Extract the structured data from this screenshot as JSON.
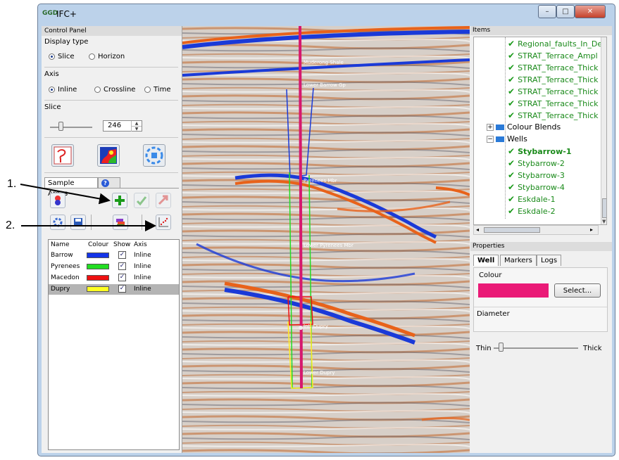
{
  "window": {
    "title": "IFC+",
    "minimize": "–",
    "maximize": "□",
    "close": "✕"
  },
  "control_panel": {
    "title": "Control Panel",
    "display_type": {
      "label": "Display type",
      "options": [
        {
          "label": "Slice",
          "selected": true
        },
        {
          "label": "Horizon",
          "selected": false
        }
      ]
    },
    "axis": {
      "label": "Axis",
      "options": [
        {
          "label": "Inline",
          "selected": true
        },
        {
          "label": "Crossline",
          "selected": false
        },
        {
          "label": "Time",
          "selected": false
        }
      ]
    },
    "slice": {
      "label": "Slice",
      "value": "246"
    },
    "tabs": [
      {
        "label": "Sample Areas",
        "active": true
      },
      {
        "label": "?",
        "active": false
      }
    ],
    "table": {
      "headers": [
        "Name",
        "Colour",
        "Show",
        "Axis"
      ],
      "rows": [
        {
          "name": "Barrow",
          "colour": "#1434e8",
          "show": true,
          "axis": "Inline",
          "selected": false
        },
        {
          "name": "Pyrenees",
          "colour": "#22dd22",
          "show": true,
          "axis": "Inline",
          "selected": false
        },
        {
          "name": "Macedon",
          "colour": "#ee1111",
          "show": true,
          "axis": "Inline",
          "selected": false
        },
        {
          "name": "Dupry",
          "colour": "#ffff22",
          "show": true,
          "axis": "Inline",
          "selected": true
        }
      ]
    }
  },
  "annotations": [
    {
      "label": "1."
    },
    {
      "label": "2."
    }
  ],
  "seismic": {
    "horizon_labels": [
      "Muderong Shale",
      "Lower Barrow Gp",
      "Pyrenees Mbr",
      "Lower Pyrenees Mbr",
      "Int. Dupry",
      "Lower Dupry"
    ],
    "well_color": "#d6186e"
  },
  "items": {
    "title": "Items",
    "tree": [
      {
        "label": "Regional_faults_In_De",
        "checked": true,
        "bold": false
      },
      {
        "label": "STRAT_Terrace_Ampl",
        "checked": true,
        "bold": false
      },
      {
        "label": "STRAT_Terrace_Thick",
        "checked": true,
        "bold": false
      },
      {
        "label": "STRAT_Terrace_Thick",
        "checked": true,
        "bold": false
      },
      {
        "label": "STRAT_Terrace_Thick",
        "checked": true,
        "bold": false
      },
      {
        "label": "STRAT_Terrace_Thick",
        "checked": true,
        "bold": false
      },
      {
        "label": "STRAT_Terrace_Thick",
        "checked": true,
        "bold": false
      },
      {
        "label": "Colour Blends",
        "checked": false,
        "bold": false,
        "folder": true,
        "expander": "+"
      },
      {
        "label": "Wells",
        "checked": false,
        "bold": false,
        "folder": true,
        "expander": "−"
      },
      {
        "label": "Stybarrow-1",
        "checked": true,
        "bold": true
      },
      {
        "label": "Stybarrow-2",
        "checked": true,
        "bold": false
      },
      {
        "label": "Stybarrow-3",
        "checked": true,
        "bold": false
      },
      {
        "label": "Stybarrow-4",
        "checked": true,
        "bold": false
      },
      {
        "label": "Eskdale-1",
        "checked": true,
        "bold": false
      },
      {
        "label": "Eskdale-2",
        "checked": true,
        "bold": false
      }
    ]
  },
  "properties": {
    "title": "Properties",
    "tabs": [
      {
        "label": "Well",
        "active": true
      },
      {
        "label": "Markers",
        "active": false
      },
      {
        "label": "Logs",
        "active": false
      }
    ],
    "colour_label": "Colour",
    "colour_value": "#ea1a77",
    "select_button": "Select...",
    "diameter_label": "Diameter",
    "thin_label": "Thin",
    "thick_label": "Thick"
  }
}
